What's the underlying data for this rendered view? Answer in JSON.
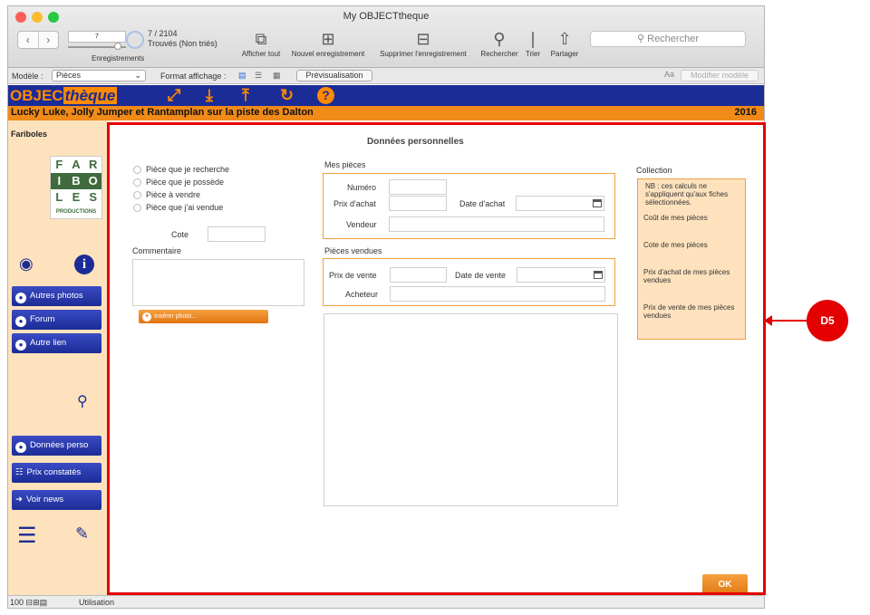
{
  "window": {
    "title": "My OBJECTtheque"
  },
  "toolbar": {
    "record_field": "7",
    "records_label": "Enregistrements",
    "count": "7 / 2104",
    "count_sub": "Trouvés (Non triés)",
    "show_all": "Afficher tout",
    "new_record": "Nouvel enregistrement",
    "delete_record": "Supprimer l'enregistrement",
    "find": "Rechercher",
    "sort": "Trier",
    "share": "Partager",
    "search_placeholder": "Rechercher"
  },
  "layoutbar": {
    "model_label": "Modèle :",
    "model_value": "Pièces",
    "format_label": "Format affichage :",
    "preview": "Prévisualisation",
    "font_glyph": "Aa",
    "modify_model": "Modifier modèle"
  },
  "header": {
    "logo_a": "OBJEC",
    "logo_b": "thèque",
    "record_title": "Lucky Luke, Jolly Jumper et Rantamplan sur la piste des Dalton",
    "year": "2016"
  },
  "sidebar": {
    "title": "Fariboles",
    "logo_letters": [
      "F",
      "A",
      "R",
      "I",
      "B",
      "O",
      "L",
      "E",
      "S"
    ],
    "logo_sub": "PRODUCTIONS",
    "buttons": {
      "other_photos": "Autres photos",
      "forum": "Forum",
      "other_link": "Autre lien",
      "personal_data": "Données perso",
      "observed_prices": "Prix constatés",
      "news": "Voir news"
    }
  },
  "form": {
    "title": "Données personnelles",
    "radios": {
      "wanted": "Pièce que je recherche",
      "owned": "Pièce que je possède",
      "for_sale": "Pièce à vendre",
      "sold": "Pièce que j'ai vendue"
    },
    "rating_label": "Cote",
    "comment_label": "Commentaire",
    "insert_photo": "Insérer photo...",
    "my_pieces": {
      "title": "Mes pièces",
      "number": "Numéro",
      "purchase_price": "Prix d'achat",
      "purchase_date": "Date d'achat",
      "seller": "Vendeur"
    },
    "sold_pieces": {
      "title": "Pièces vendues",
      "sale_price": "Prix de vente",
      "sale_date": "Date de vente",
      "buyer": "Acheteur"
    },
    "collection": {
      "title": "Collection",
      "note": "NB : ces calculs ne s'appliquent qu'aux fiches sélectionnées.",
      "cost": "Coût de mes pièces",
      "rating": "Cote de mes pièces",
      "purchase_total": "Prix d'achat de mes pièces vendues",
      "sale_total": "Prix de vente de mes pièces vendues"
    },
    "ok": "OK"
  },
  "status": {
    "zoom": "100",
    "mode": "Utilisation"
  },
  "annotation": {
    "label": "D5"
  },
  "colors": {
    "brand_blue": "#1c2c96",
    "brand_orange": "#f08a18",
    "highlight_red": "#e40000",
    "sidebar_bg": "#fde2bd"
  }
}
